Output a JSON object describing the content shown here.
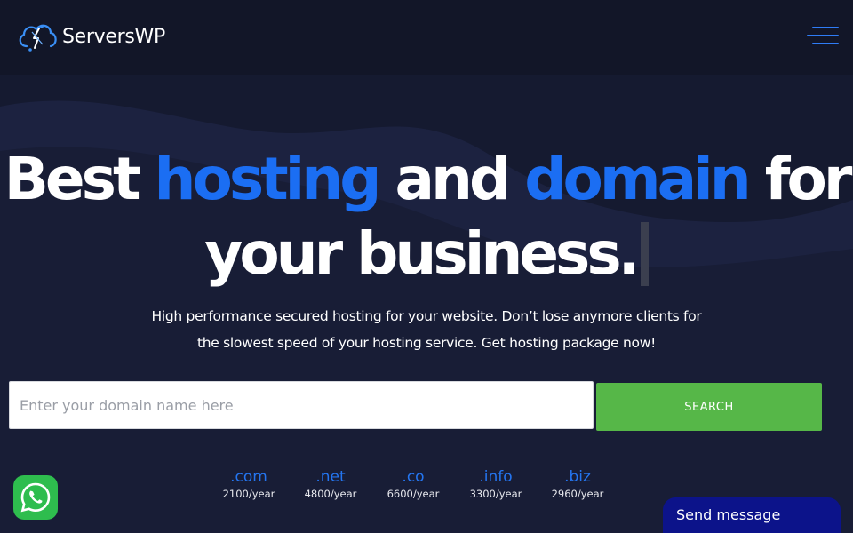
{
  "brand": {
    "name": "ServersWP",
    "logo_icon": "cloud-lightning-icon"
  },
  "nav": {
    "menu_icon": "hamburger-menu-icon"
  },
  "hero": {
    "line1": {
      "w1": "Best ",
      "w2": "hosting",
      "w3": " and ",
      "w4": "domain",
      "w5": " for"
    },
    "line2": {
      "text": "your business."
    },
    "subtitle_line1": "High performance secured hosting for your website. Don’t lose anymore clients for",
    "subtitle_line2": "the slowest speed of your hosting service. Get hosting package now!"
  },
  "search": {
    "placeholder": "Enter your domain name here",
    "value": "",
    "button_label": "SEARCH"
  },
  "tlds": [
    {
      "ext": ".com",
      "price": "2100/year"
    },
    {
      "ext": ".net",
      "price": "4800/year"
    },
    {
      "ext": ".co",
      "price": "6600/year"
    },
    {
      "ext": ".info",
      "price": "3300/year"
    },
    {
      "ext": ".biz",
      "price": "2960/year"
    }
  ],
  "chat": {
    "send_label": "Send message",
    "whatsapp_icon": "whatsapp-icon"
  },
  "colors": {
    "background": "#151a30",
    "accent": "#1b6ef3",
    "search_button": "#56b748",
    "chat_widget": "#0c138a"
  }
}
